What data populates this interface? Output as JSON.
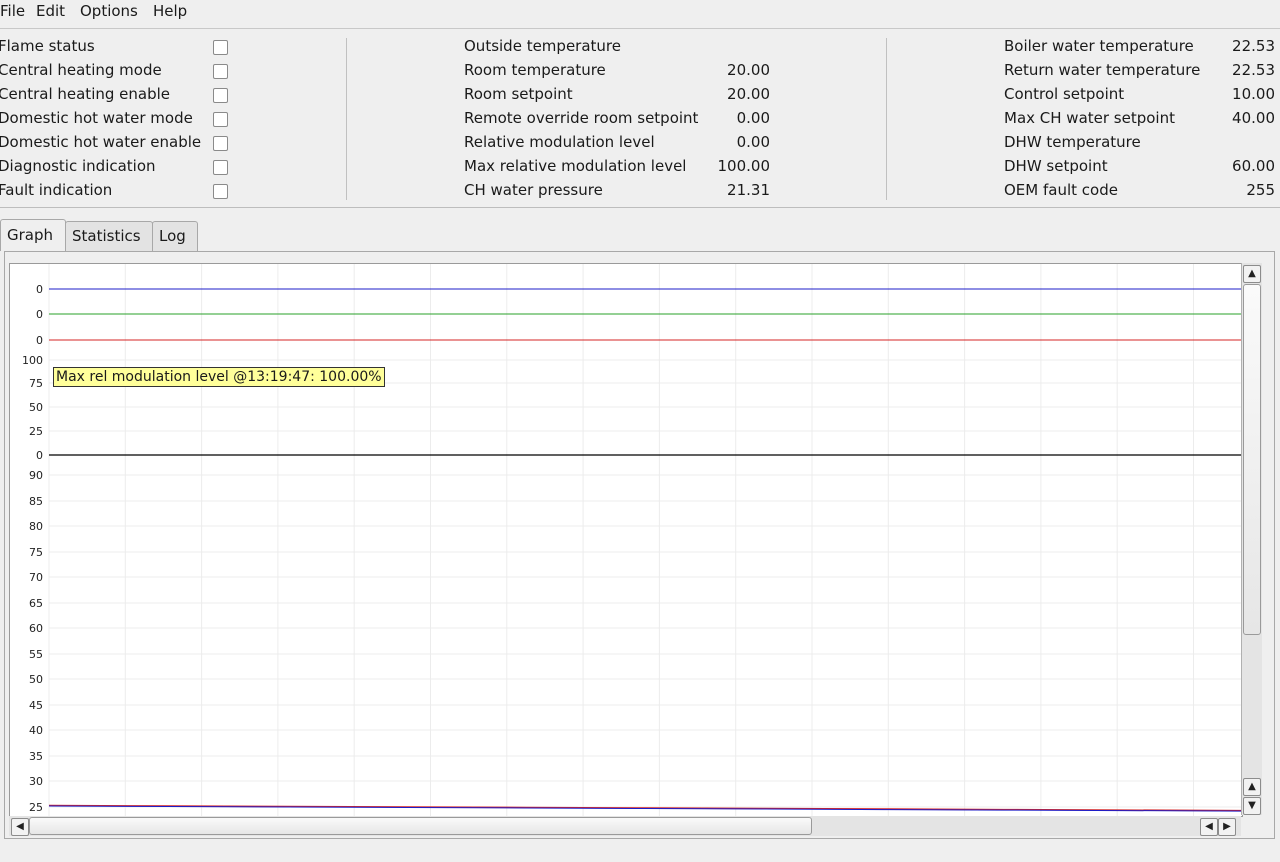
{
  "menu": [
    "File",
    "Edit",
    "Options",
    "Help"
  ],
  "flags": [
    {
      "label": "Flame status",
      "checked": false
    },
    {
      "label": "Central heating mode",
      "checked": false
    },
    {
      "label": "Central heating enable",
      "checked": false
    },
    {
      "label": "Domestic hot water mode",
      "checked": false
    },
    {
      "label": "Domestic hot water enable",
      "checked": false
    },
    {
      "label": "Diagnostic indication",
      "checked": false
    },
    {
      "label": "Fault indication",
      "checked": false
    }
  ],
  "middle": [
    {
      "label": "Outside temperature",
      "value": ""
    },
    {
      "label": "Room temperature",
      "value": "20.00"
    },
    {
      "label": "Room setpoint",
      "value": "20.00"
    },
    {
      "label": "Remote override room setpoint",
      "value": "0.00"
    },
    {
      "label": "Relative modulation level",
      "value": "0.00"
    },
    {
      "label": "Max relative modulation level",
      "value": "100.00"
    },
    {
      "label": "CH water pressure",
      "value": "21.31"
    }
  ],
  "right": [
    {
      "label": "Boiler water temperature",
      "value": "22.53"
    },
    {
      "label": "Return water temperature",
      "value": "22.53"
    },
    {
      "label": "Control setpoint",
      "value": "10.00"
    },
    {
      "label": "Max CH water setpoint",
      "value": "40.00"
    },
    {
      "label": "DHW temperature",
      "value": ""
    },
    {
      "label": "DHW setpoint",
      "value": "60.00"
    },
    {
      "label": "OEM fault code",
      "value": "255"
    }
  ],
  "tabs": [
    {
      "label": "Graph",
      "active": true
    },
    {
      "label": "Statistics",
      "active": false
    },
    {
      "label": "Log",
      "active": false
    }
  ],
  "tooltip": "Max rel modulation level @13:19:47: 100.00%",
  "chart_data": {
    "type": "line",
    "panels": [
      {
        "ticks": [
          "0"
        ],
        "series": [
          {
            "color": "#1c1cc8",
            "values": [
              0
            ]
          }
        ]
      },
      {
        "ticks": [
          "0"
        ],
        "series": [
          {
            "color": "#2aa02a",
            "values": [
              0
            ]
          }
        ]
      },
      {
        "ticks": [
          "0"
        ],
        "series": [
          {
            "color": "#d42424",
            "values": [
              0
            ]
          }
        ]
      },
      {
        "ticks": [
          "100",
          "75",
          "50",
          "25",
          "0"
        ],
        "series": [
          {
            "color": "#000000",
            "values": [
              0
            ]
          }
        ]
      },
      {
        "ticks": [
          "90",
          "85",
          "80",
          "75",
          "70",
          "65",
          "60",
          "55",
          "50",
          "45",
          "40",
          "35",
          "30",
          "25"
        ],
        "series": [
          {
            "color": "#d42424",
            "values": [
              25.3,
              25.2,
              25.1,
              25.0,
              24.9,
              24.8,
              24.7,
              24.6,
              24.5,
              24.4,
              24.3
            ]
          },
          {
            "color": "#1c1cc8",
            "values": [
              25.2,
              25.1,
              25.0,
              24.9,
              24.8,
              24.7,
              24.6,
              24.5,
              24.4,
              24.3,
              24.2
            ]
          }
        ]
      }
    ]
  }
}
